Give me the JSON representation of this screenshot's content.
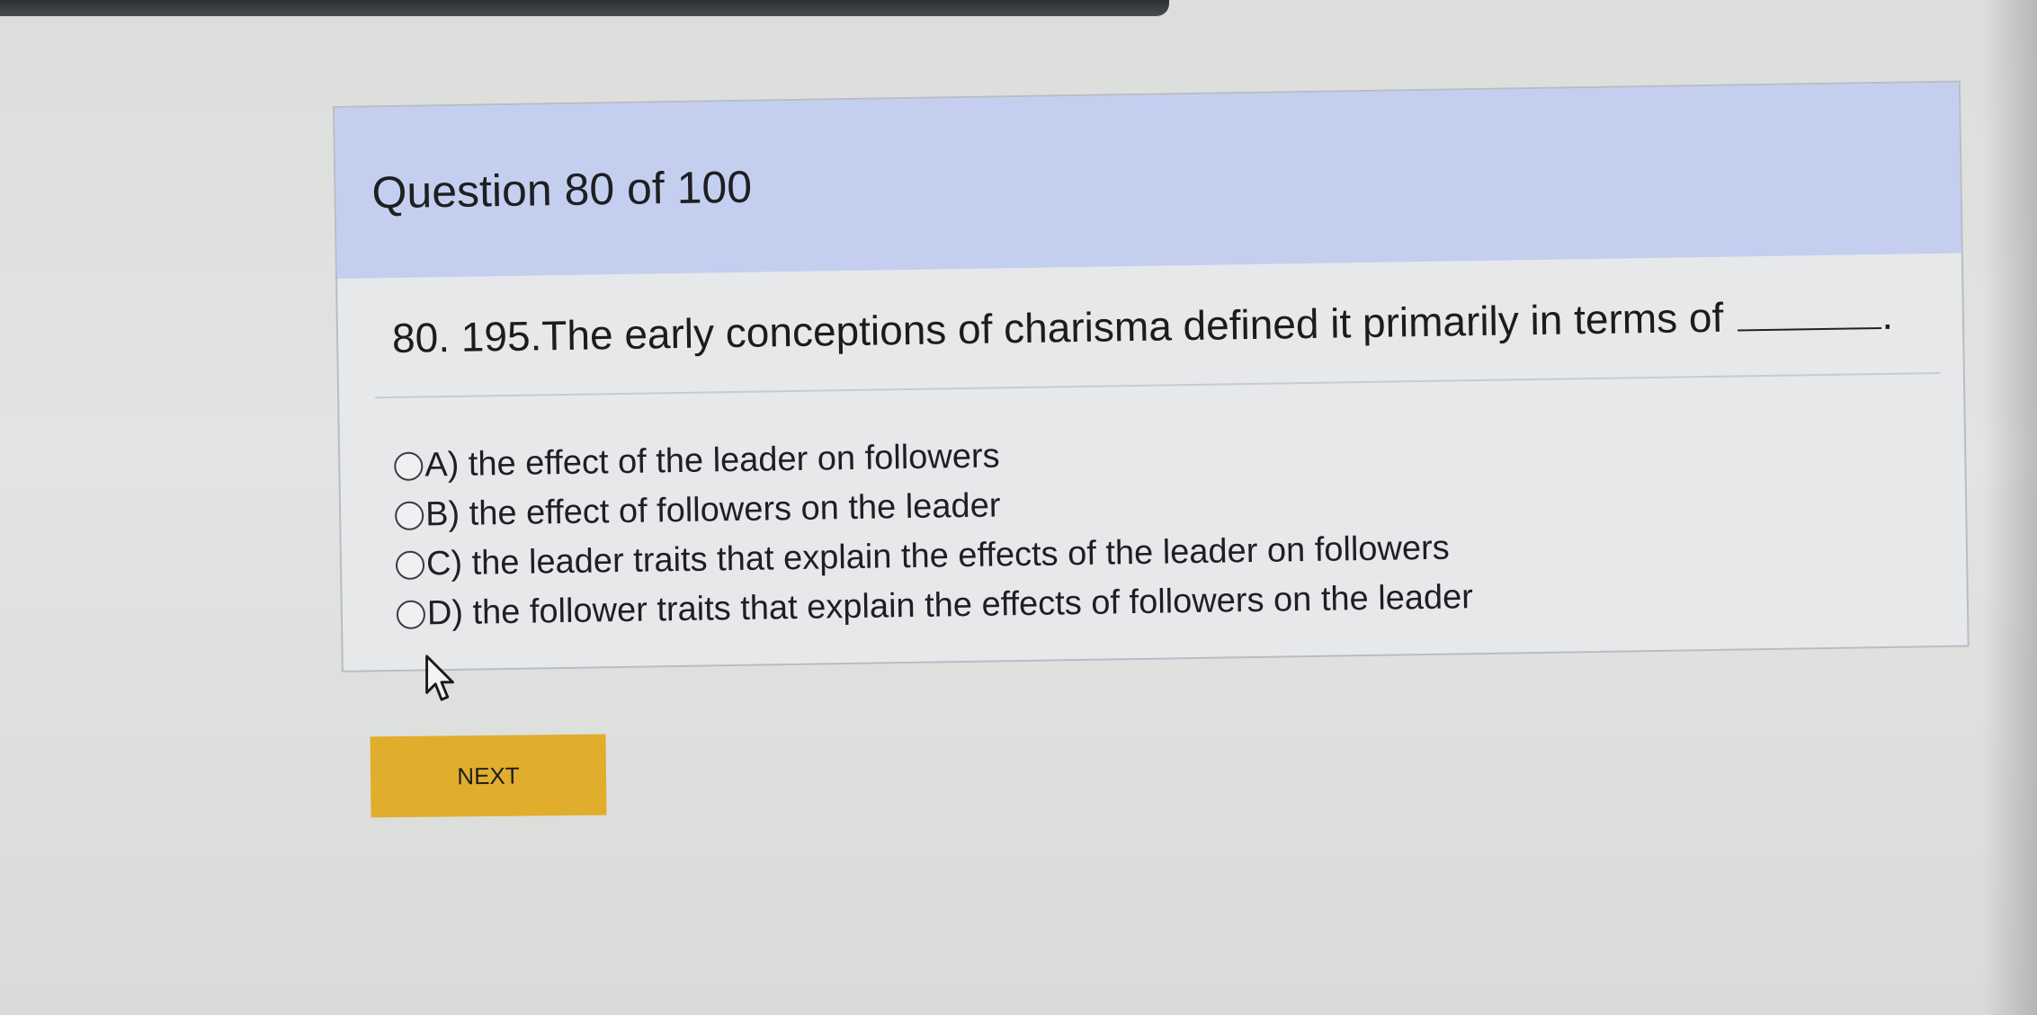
{
  "quiz": {
    "question_counter": "Question 80 of 100",
    "question_text": "80. 195.The early conceptions of charisma defined it primarily in terms of",
    "blank_suffix": ".",
    "options": [
      {
        "label": "A) the effect of the leader on followers"
      },
      {
        "label": "B) the effect of followers on the leader"
      },
      {
        "label": "C) the leader traits that explain the effects of the leader on followers"
      },
      {
        "label": "D) the follower traits that explain the effects of followers on the leader"
      }
    ],
    "selected_option": null
  },
  "footer": {
    "next_label": "NEXT"
  },
  "colors": {
    "header_bg": "#c4cff0",
    "card_bg": "#e6e8ea",
    "next_button_bg": "#e1ad2c",
    "page_bg": "#e0e1df"
  },
  "icons": {
    "radio": "radio-unselected-icon",
    "pointer": "mouse-pointer-icon"
  }
}
